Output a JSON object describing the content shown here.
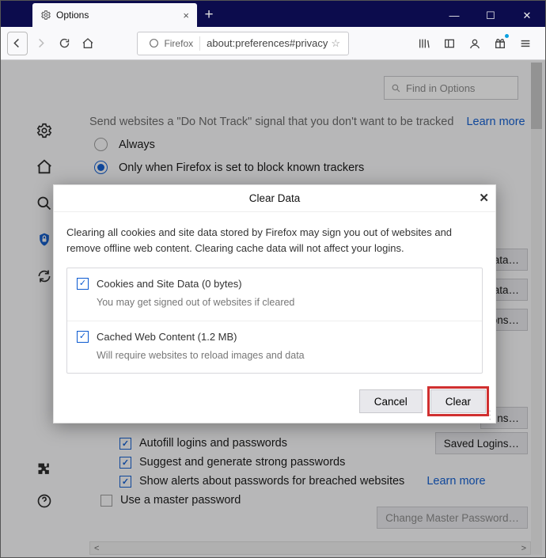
{
  "window": {
    "tab_title": "Options",
    "new_tab": "+",
    "close": "×",
    "minimize": "—",
    "maximize": "☐",
    "win_close": "✕"
  },
  "urlbar": {
    "identity": "Firefox",
    "url": "about:preferences#privacy"
  },
  "search": {
    "placeholder": "Find in Options"
  },
  "page": {
    "cutoff_text": "Send websites a \"Do Not Track\" signal that you don't want to be tracked",
    "cutoff_link": "Learn more",
    "radio1": "Always",
    "radio2": "Only when Firefox is set to block known trackers",
    "btn_data1": "ata…",
    "btn_data2": "Data…",
    "btn_perm": "issions…",
    "btn_ns": "ns…",
    "chk_autofill": "Autofill logins and passwords",
    "chk_suggest": "Suggest and generate strong passwords",
    "chk_alerts": "Show alerts about passwords for breached websites",
    "btn_saved": "Saved Logins…",
    "chk_master": "Use a master password",
    "btn_master": "Change Master Password…",
    "learn_more": "Learn more"
  },
  "dialog": {
    "title": "Clear Data",
    "desc": "Clearing all cookies and site data stored by Firefox may sign you out of websites and remove offline web content. Clearing cache data will not affect your logins.",
    "item1_title": "Cookies and Site Data (0 bytes)",
    "item1_sub": "You may get signed out of websites if cleared",
    "item2_title": "Cached Web Content (1.2 MB)",
    "item2_sub": "Will require websites to reload images and data",
    "cancel": "Cancel",
    "clear": "Clear"
  }
}
